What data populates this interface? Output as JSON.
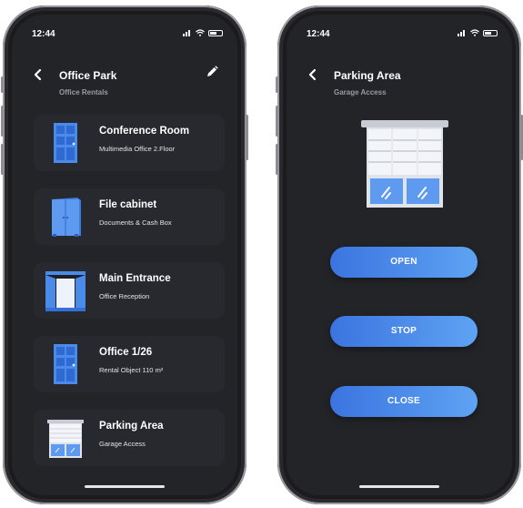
{
  "left": {
    "time": "12:44",
    "header": {
      "title": "Office Park",
      "subtitle": "Office Rentals"
    },
    "items": [
      {
        "title": "Conference Room",
        "subtitle": "Multimedia Office 2.Floor",
        "icon": "door-icon"
      },
      {
        "title": "File cabinet",
        "subtitle": "Documents & Cash Box",
        "icon": "cabinet-icon"
      },
      {
        "title": "Main Entrance",
        "subtitle": "Office Reception",
        "icon": "double-door-icon"
      },
      {
        "title": "Office 1/26",
        "subtitle": "Rental Object 110 m²",
        "icon": "door-icon"
      },
      {
        "title": "Parking Area",
        "subtitle": "Garage Access",
        "icon": "garage-shutter-icon"
      }
    ]
  },
  "right": {
    "time": "12:44",
    "header": {
      "title": "Parking Area",
      "subtitle": "Garage Access"
    },
    "buttons": {
      "open": "OPEN",
      "stop": "STOP",
      "close": "CLOSE"
    }
  },
  "colors": {
    "background": "#232428",
    "card": "#28292e",
    "accent": "#4a8ae8",
    "subtle_text": "#9a9ba2"
  }
}
